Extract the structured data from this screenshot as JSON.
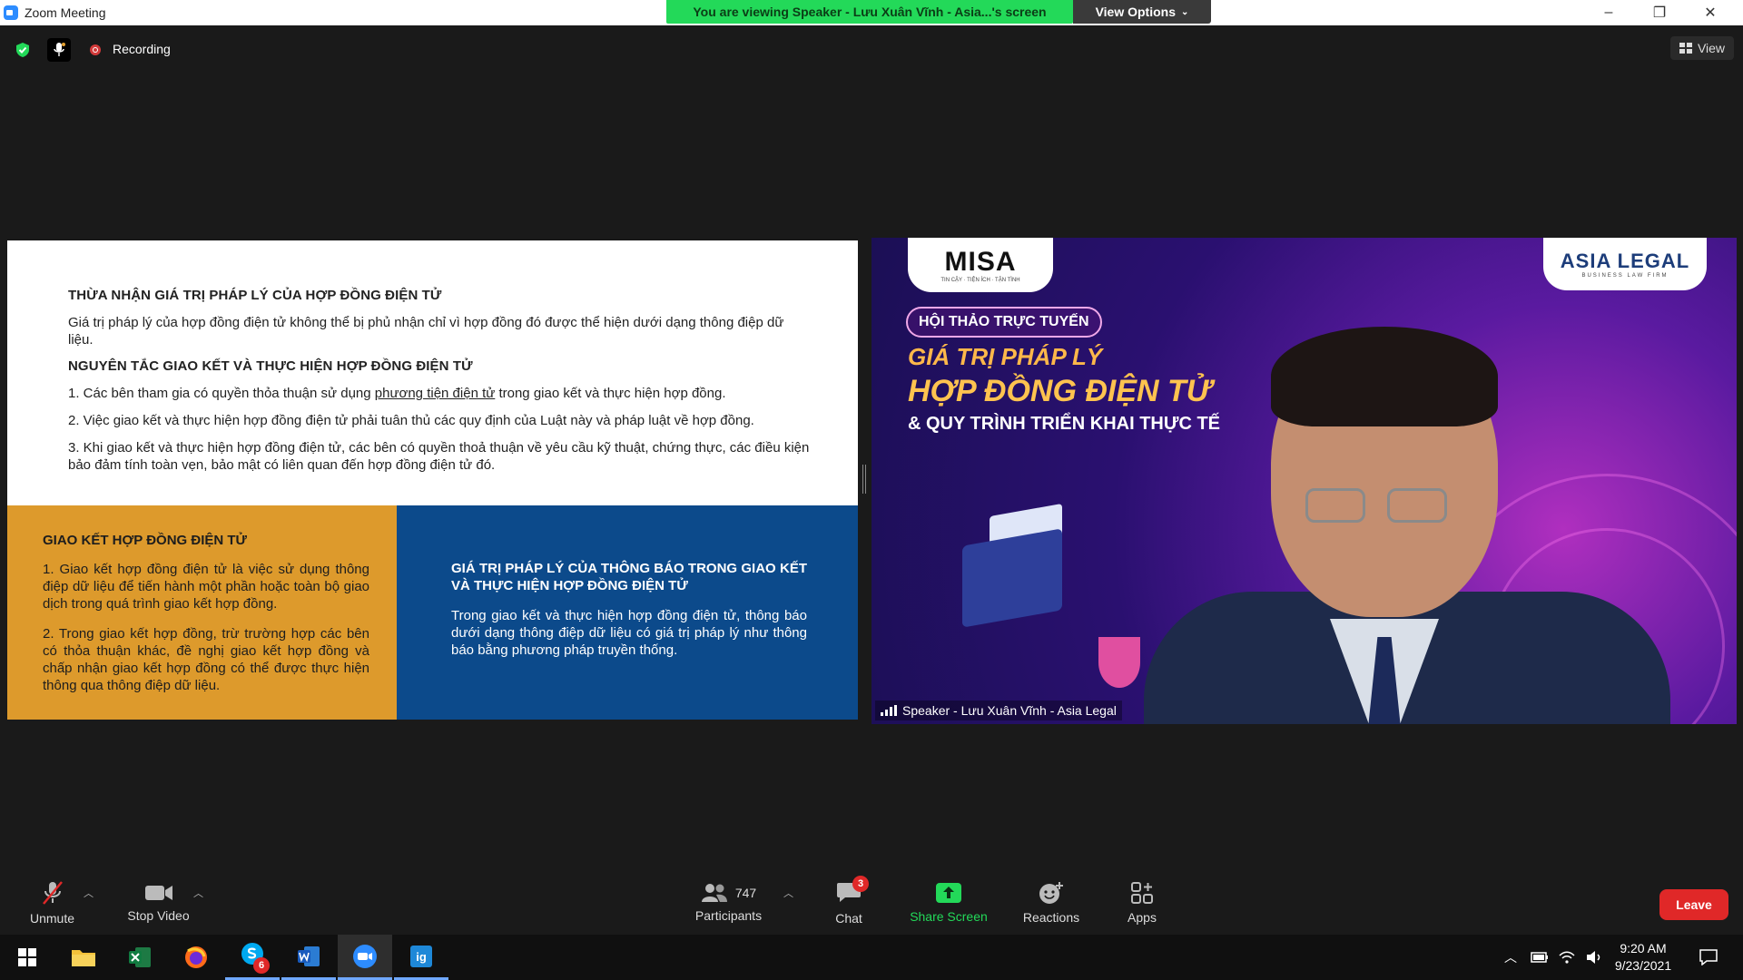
{
  "window": {
    "title": "Zoom Meeting",
    "viewing_banner": "You are viewing Speaker - Lưu Xuân Vĩnh - Asia...'s screen",
    "view_options": "View Options",
    "minimize": "–",
    "restore": "❐",
    "close": "✕"
  },
  "topbar": {
    "recording_label": "Recording",
    "view_label": "View"
  },
  "slide": {
    "heading1": "THỪA NHẬN GIÁ TRỊ PHÁP LÝ CỦA HỢP ĐỒNG ĐIỆN TỬ",
    "para1": "Giá trị pháp lý của hợp đồng điện tử không thể bị phủ nhận chỉ vì hợp đồng đó được thể hiện dưới dạng thông điệp dữ liệu.",
    "heading2": "NGUYÊN TẮC GIAO KẾT VÀ THỰC HIỆN HỢP ĐỒNG ĐIỆN TỬ",
    "item1_pre": "1. Các bên tham gia có quyền thỏa thuận sử dụng ",
    "item1_link": "phương tiện điện tử",
    "item1_post": " trong giao kết và thực hiện hợp đồng.",
    "item2": "2. Việc giao kết và thực hiện hợp đồng điện tử phải tuân thủ các quy định của Luật này và pháp luật về hợp đồng.",
    "item3": "3. Khi giao kết và thực hiện hợp đồng điện tử, các bên có quyền thoả thuận về yêu cầu kỹ thuật, chứng thực, các điều kiện bảo đảm tính toàn vẹn, bảo mật có liên quan đến hợp đồng điện tử đó.",
    "left_heading": "GIAO KẾT HỢP ĐỒNG ĐIỆN TỬ",
    "left_p1": "1. Giao kết hợp đồng điện tử là việc sử dụng thông điệp dữ liệu để tiến hành một phần hoặc toàn bộ giao dịch trong quá trình giao kết hợp đồng.",
    "left_p2": "2. Trong giao kết hợp đồng, trừ trường hợp các bên có thỏa thuận khác, đề nghị giao kết hợp đồng và chấp nhận giao kết hợp đồng có thể được thực hiện thông qua thông điệp dữ liệu.",
    "right_heading": "GIÁ TRỊ PHÁP LÝ CỦA THÔNG BÁO TRONG GIAO KẾT VÀ THỰC HIỆN HỢP ĐỒNG ĐIỆN TỬ",
    "right_p": "Trong giao kết và thực hiện hợp đồng điện tử, thông báo dưới dạng thông điệp dữ liệu có giá trị pháp lý như thông báo bằng phương pháp truyền thống.",
    "orange_color": "#dd9a2c",
    "blue_color": "#0c4a8b"
  },
  "video": {
    "misa_logo": "MISA",
    "misa_tagline": "TIN CẬY · TIỆN ÍCH · TẬN TÌNH",
    "asia_logo": "ASIA LEGAL",
    "asia_tagline": "BUSINESS LAW FIRM",
    "event_pill": "HỘI THẢO TRỰC TUYẾN",
    "title_line1": "GIÁ TRỊ PHÁP LÝ",
    "title_line2": "HỢP ĐỒNG ĐIỆN TỬ",
    "title_line3": "& QUY TRÌNH TRIỂN KHAI THỰC TẾ",
    "speaker_label": "Speaker - Lưu Xuân Vĩnh - Asia Legal"
  },
  "toolbar": {
    "unmute": "Unmute",
    "stop_video": "Stop Video",
    "participants": "Participants",
    "participant_count": "747",
    "chat": "Chat",
    "chat_badge": "3",
    "share_screen": "Share Screen",
    "reactions": "Reactions",
    "apps": "Apps",
    "leave": "Leave",
    "share_color": "#23d959"
  },
  "taskbar": {
    "skype_badge": "6",
    "time": "9:20 AM",
    "date": "9/23/2021"
  }
}
